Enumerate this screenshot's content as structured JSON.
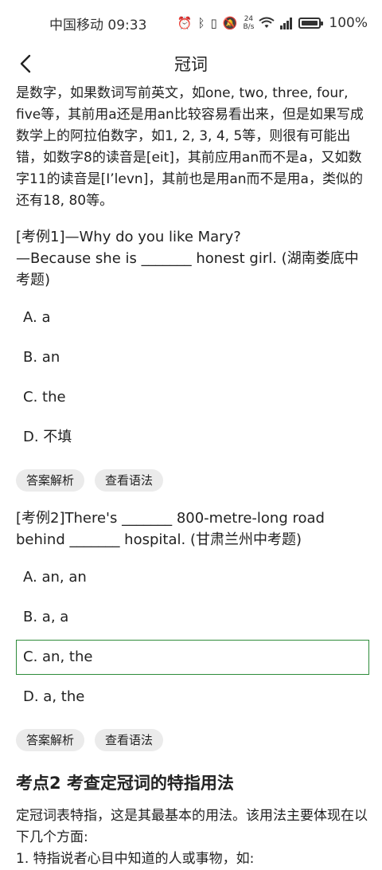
{
  "status_bar": {
    "carrier_time": "中国移动 09:33",
    "net_speed_value": "24",
    "net_speed_unit": "B/s",
    "battery": "100%",
    "icons": [
      "alarm-icon",
      "bluetooth-icon",
      "vibrate-icon",
      "mute-icon",
      "wifi-icon",
      "signal-icon",
      "battery-icon"
    ]
  },
  "header": {
    "title": "冠词",
    "back_icon": "back-arrow-icon"
  },
  "content": {
    "intro_paragraph": "是数字，如果数词写前英文，如one, two, three, four, five等，其前用a还是用an比较容易看出来，但是如果写成数学上的阿拉伯数字，如1, 2, 3, 4, 5等，则很有可能出错，如数字8的读音是[eit]，其前应用an而不是a，又如数字11的读音是[I’levn]，其前也是用an而不是用a，类似的还有18, 80等。",
    "examples": [
      {
        "question_line1": "[考例1]—Why do you like Mary?",
        "question_line2": "—Because she is _______ honest girl. (湖南娄底中考题)",
        "options": [
          "A. a",
          "B. an",
          "C. the",
          "D. 不填"
        ],
        "answer_button": "答案解析",
        "grammar_button": "查看语法"
      },
      {
        "question": "[考例2]There's _______ 800-metre-long road behind _______ hospital. (甘肃兰州中考题)",
        "options": [
          "A. an, an",
          "B. a, a",
          "C. an, the",
          "D. a, the"
        ],
        "selected_option": "C. an, the",
        "answer_button": "答案解析",
        "grammar_button": "查看语法"
      }
    ],
    "section_heading": "考点2 考查定冠词的特指用法",
    "section_paragraph": "定冠词表特指，这是其最基本的用法。该用法主要体现在以下几个方面:",
    "cut_line": "1. 特指说者心目中知道的人或事物，如:"
  },
  "colors": {
    "selected_border": "#2e8b3a",
    "pill_bg": "#ebebeb"
  }
}
